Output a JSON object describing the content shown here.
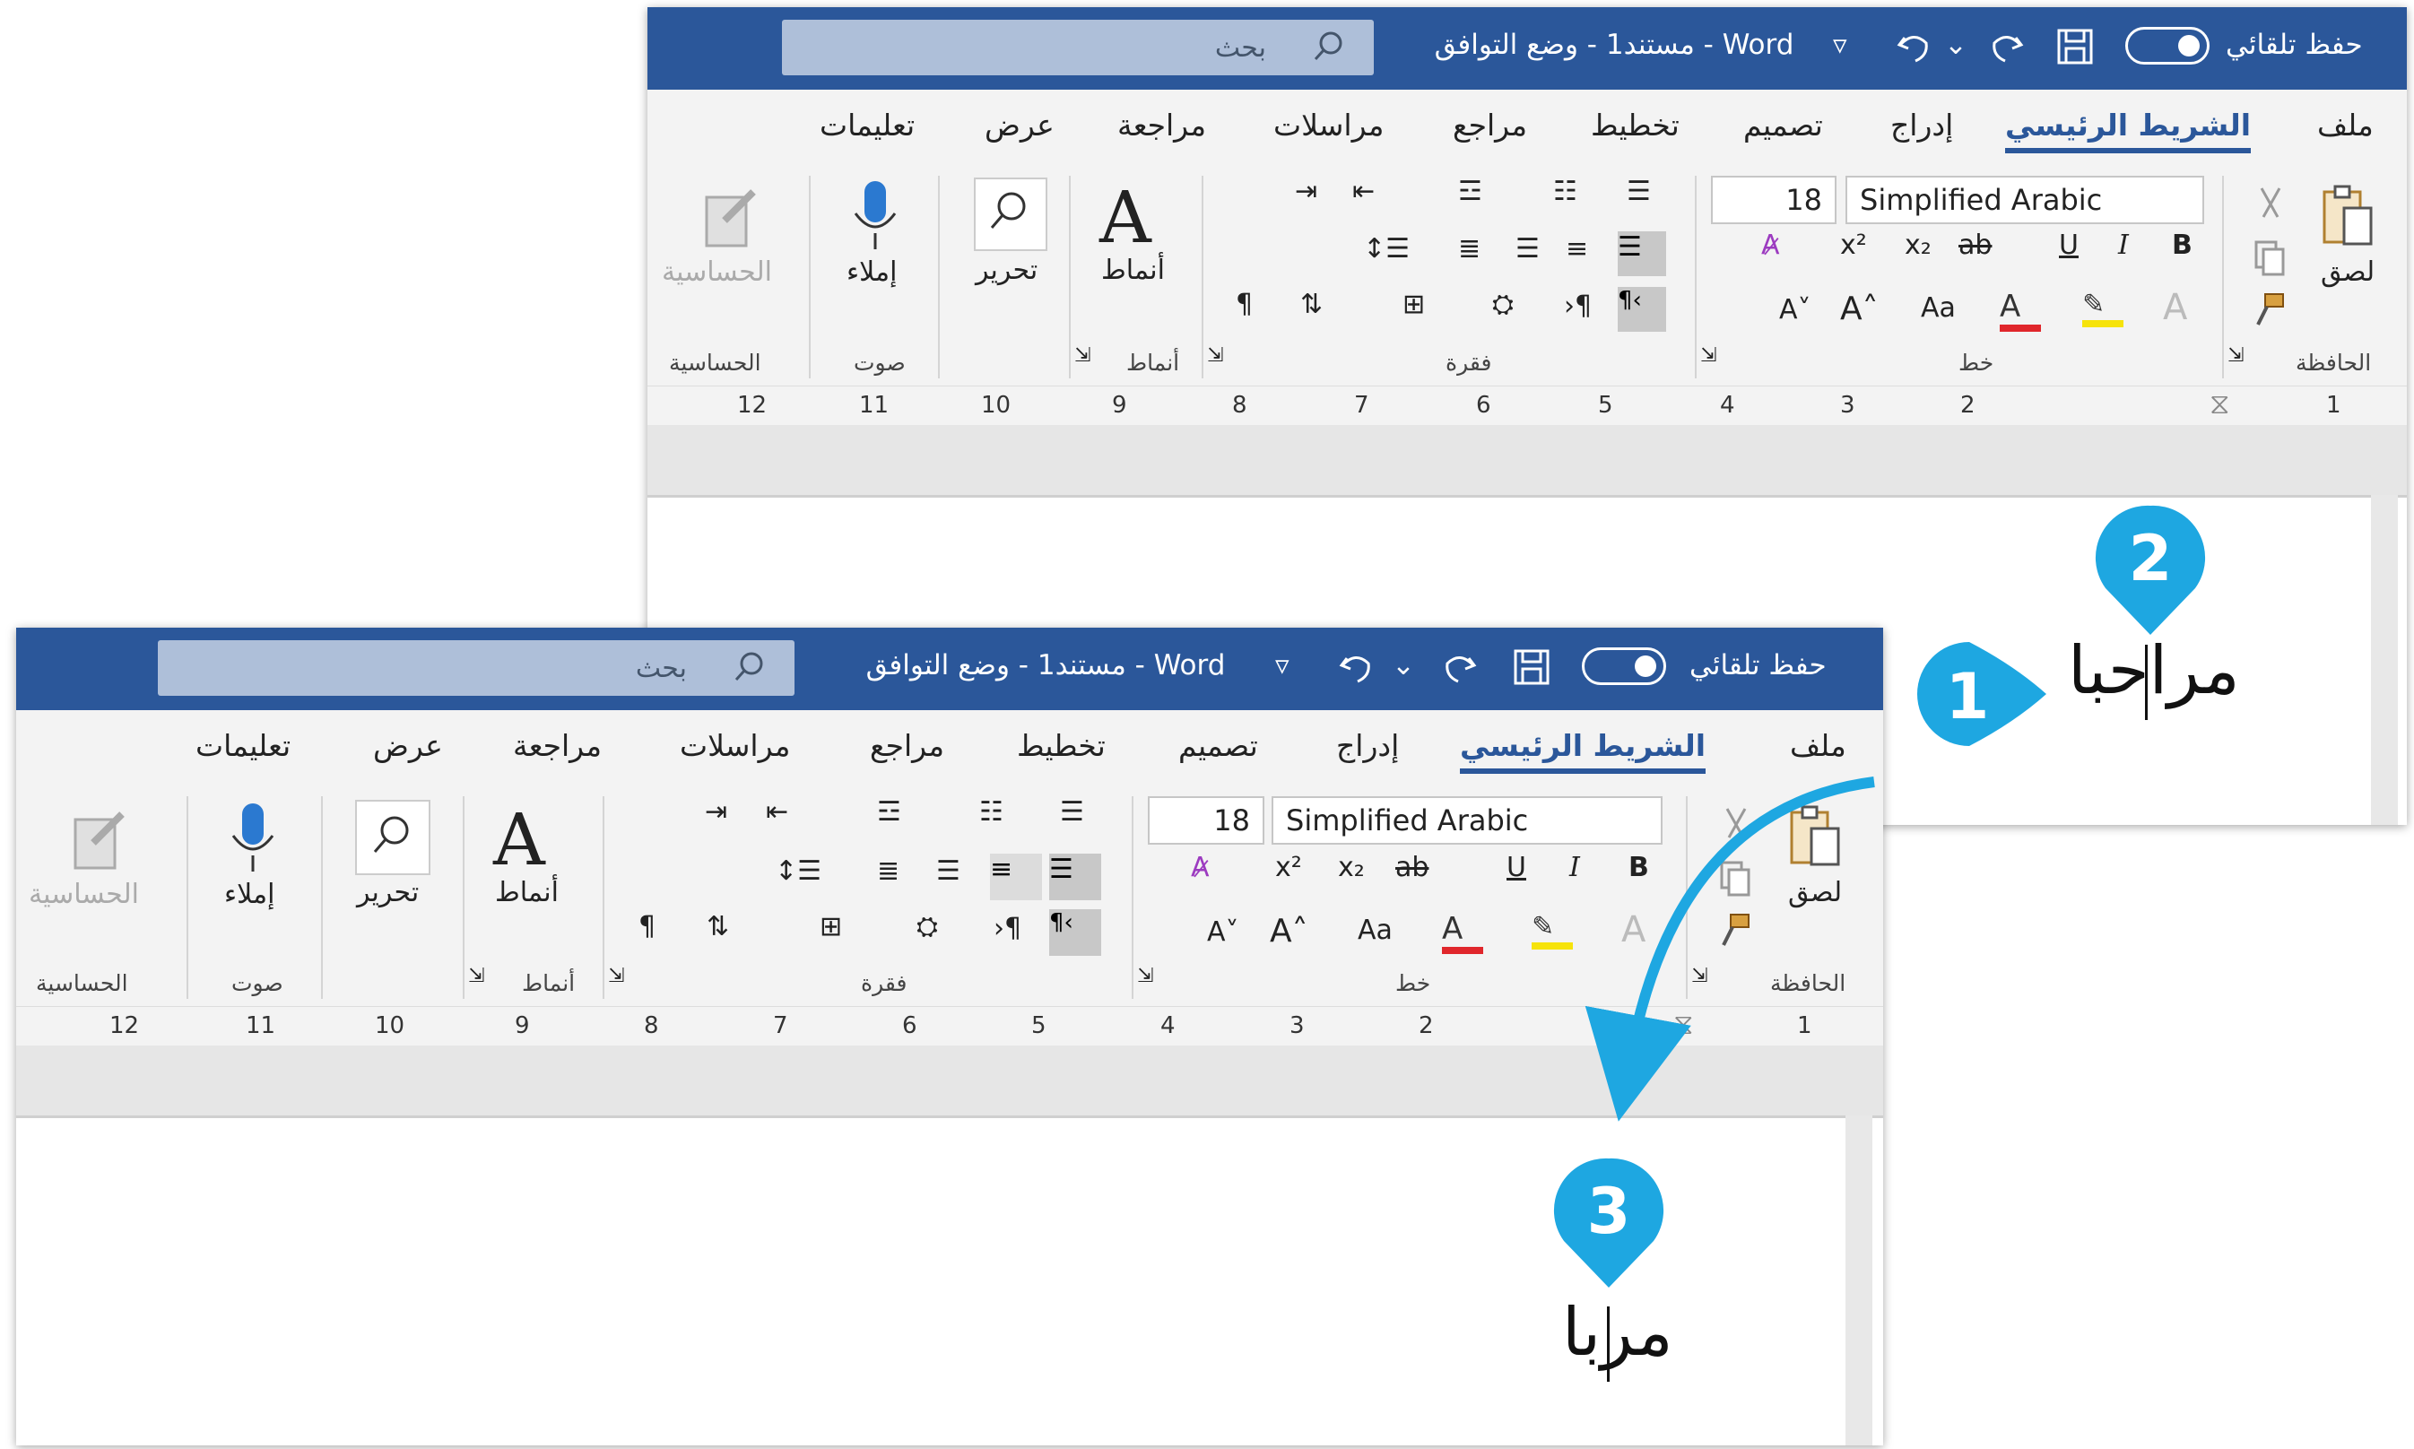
{
  "window": {
    "autosave_label": "حفظ تلقائي",
    "title": "مستند1  -  وضع التوافق  -  Word",
    "search_placeholder": "بحث"
  },
  "tabs": [
    "ملف",
    "الشريط الرئيسي",
    "إدراج",
    "تصميم",
    "تخطيط",
    "مراجع",
    "مراسلات",
    "مراجعة",
    "عرض",
    "تعليمات"
  ],
  "active_tab": "الشريط الرئيسي",
  "ribbon": {
    "groups": {
      "clipboard": "الحافظة",
      "font": "خط",
      "paragraph": "فقرة",
      "styles": "أنماط",
      "voice": "صوت",
      "sensitivity": "الحساسية"
    },
    "buttons": {
      "paste": "لصق",
      "styles": "أنماط",
      "editing": "تحرير",
      "dictate": "إملاء",
      "sensitivity": "الحساسية"
    },
    "font_name": "Simplified Arabic",
    "font_size": "18"
  },
  "ruler_numbers": [
    "1",
    "2",
    "3",
    "4",
    "5",
    "6",
    "7",
    "8",
    "9",
    "10",
    "11",
    "12"
  ],
  "document": {
    "text_before": "مراحبا",
    "text_after": "مربا"
  },
  "callouts": [
    "1",
    "2",
    "3"
  ],
  "colors": {
    "title_bar": "#2b579a",
    "callout": "#1ea7e1",
    "font_color": "#e0262b",
    "highlight": "#f6e30b"
  }
}
